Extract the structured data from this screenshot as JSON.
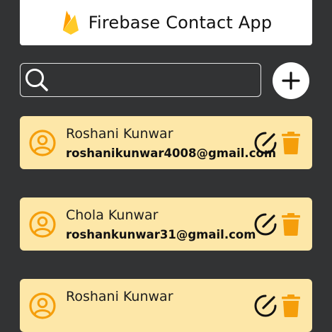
{
  "app": {
    "title": "Firebase Contact App"
  },
  "search": {
    "value": "",
    "placeholder": ""
  },
  "contacts": [
    {
      "name": "Roshani Kunwar",
      "email": "roshanikunwar4008@gmail.com"
    },
    {
      "name": "Chola Kunwar",
      "email": "roshankunwar31@gmail.com"
    },
    {
      "name": "Roshani Kunwar",
      "email": ""
    }
  ],
  "icons": {
    "logo": "firebase-logo",
    "search": "search-icon",
    "add": "plus-icon",
    "avatar": "user-circle-icon",
    "edit": "edit-icon",
    "delete": "trash-icon"
  },
  "colors": {
    "background": "#323334",
    "card": "#fde7a8",
    "accent_orange": "#f59e0b",
    "header": "#ffffff"
  }
}
